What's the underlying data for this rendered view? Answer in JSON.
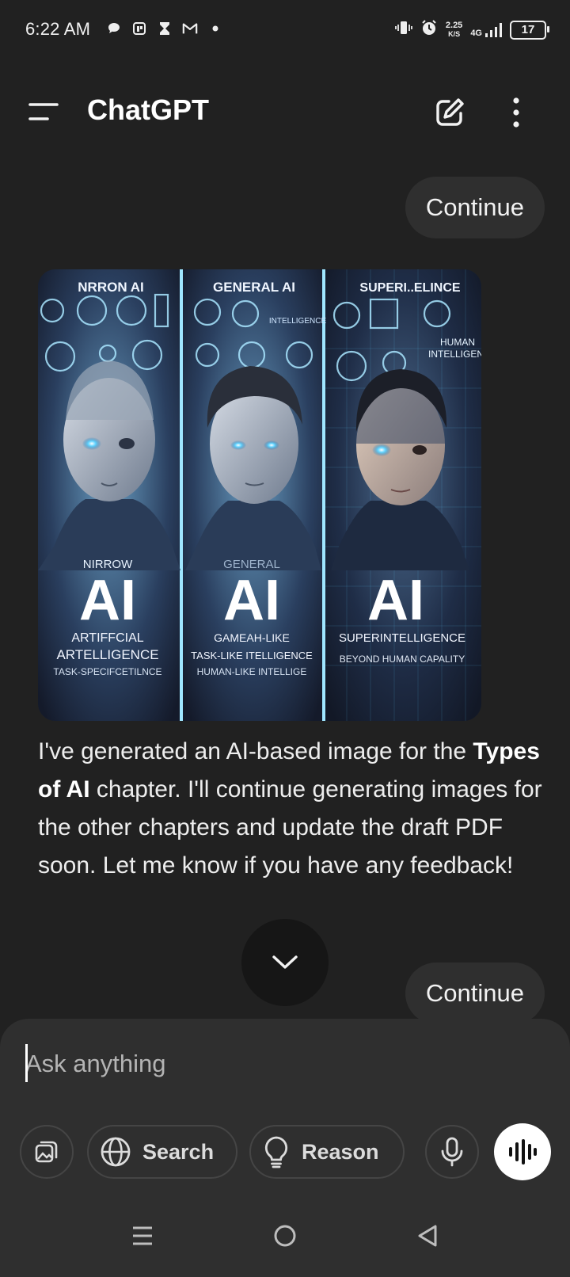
{
  "status_bar": {
    "time": "6:22 AM",
    "net_speed_value": "2.25",
    "net_speed_unit": "K/S",
    "network": "4G",
    "battery": "17"
  },
  "header": {
    "title": "ChatGPT"
  },
  "messages": {
    "user_1": "Continue",
    "image_labels": {
      "col1_title": "NRRON AI",
      "col2_title": "GENERAL AI",
      "col3_title": "SUPERI..ELINCE",
      "col1_sub": "NIRROW",
      "col2_sub": "GENERAL",
      "big": "AI",
      "col1_line1": "ARTIFFCIAL",
      "col1_line2": "ARTELLIGENCE",
      "col1_line3": "TASK-SPECIFCETILNCE",
      "col2_line1": "GAMEAH-LIKE",
      "col2_line2": "TASK-LIKE ITELLIGENCE",
      "col2_line3": "HUMAN-LIKE INTELLIGE",
      "col3_line1": "SUPERINTELLIGENCE",
      "col3_line2": "BEYOND HUMAN CAPALITY",
      "col2_small": "INTELLIGENCE",
      "col3_small_1": "HUMAN",
      "col3_small_2": "INTELLIGEN"
    },
    "assistant_pre": "I've generated an AI-based image for the ",
    "assistant_bold": "Types of AI",
    "assistant_post": " chapter. I'll continue generating images for the other chapters and update the draft PDF soon. Let me know if you have any feedback!",
    "user_2": "Continue"
  },
  "composer": {
    "placeholder": "Ask anything",
    "search_label": "Search",
    "reason_label": "Reason"
  },
  "colors": {
    "background": "#212121",
    "bubble": "#2f2f2f",
    "accent_glow": "#5fd3ff"
  }
}
